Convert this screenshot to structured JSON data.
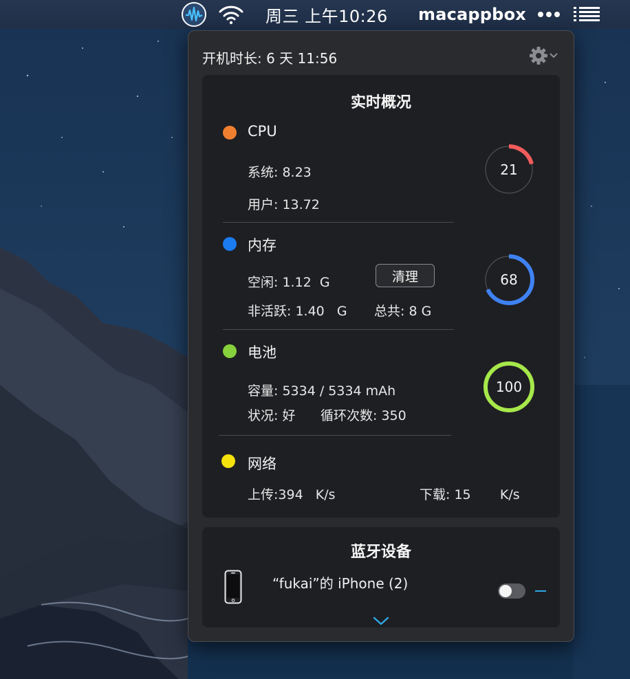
{
  "menubar": {
    "clock": "周三 上午10:26",
    "user": "macappbox",
    "icons": [
      "audio-waveform-icon",
      "wifi-icon",
      "more-dots-icon",
      "list-menu-icon"
    ]
  },
  "panel": {
    "uptime": "开机时长: 6 天 11:56",
    "settings_icon": "gear-icon",
    "realtime": {
      "title": "实时概况",
      "cpu": {
        "label": "CPU",
        "color": "#f08030",
        "system": "系统: 8.23",
        "user": "用户: 13.72",
        "ring_value": "21",
        "ring_percent": 21,
        "ring_color": "#f25c5c"
      },
      "memory": {
        "label": "内存",
        "color": "#1a7cf0",
        "free": "空闲: 1.12  G",
        "clean_button": "清理",
        "inactive": "非活跃: 1.40   G",
        "total": "总共: 8 G",
        "ring_value": "68",
        "ring_percent": 68,
        "ring_color": "#3f82f2"
      },
      "battery": {
        "label": "电池",
        "color": "#86d13c",
        "capacity": "容量: 5334 / 5334 mAh",
        "status": "状况: 好",
        "cycles": "循环次数: 350",
        "ring_value": "100",
        "ring_percent": 100,
        "ring_color": "#a6e84a"
      },
      "network": {
        "label": "网络",
        "color": "#f5e20c",
        "upload": "上传:394   K/s",
        "download": "下载: 15       K/s"
      }
    },
    "bluetooth": {
      "title": "蓝牙设备",
      "device_name": "“fukai”的 iPhone (2)",
      "device_icon": "iphone-icon",
      "toggle_on": false,
      "expand_icon": "chevron-down-icon"
    }
  }
}
